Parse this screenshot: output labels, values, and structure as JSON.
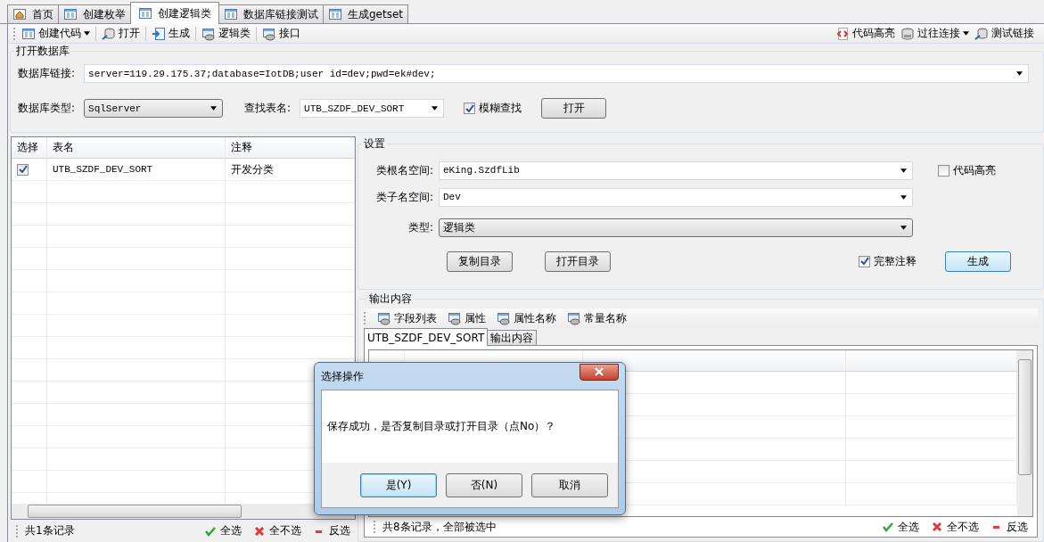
{
  "tabs": [
    {
      "label": "首页",
      "selected": false
    },
    {
      "label": "创建枚举",
      "selected": false
    },
    {
      "label": "创建逻辑类",
      "selected": true
    },
    {
      "label": "数据库链接测试",
      "selected": false
    },
    {
      "label": "生成getset",
      "selected": false
    }
  ],
  "toolbar": {
    "left": [
      {
        "label": "创建代码",
        "dropdown": true
      },
      {
        "label": "打开",
        "dropdown": false
      },
      {
        "label": "生成",
        "dropdown": false
      },
      {
        "label": "逻辑类",
        "dropdown": false
      },
      {
        "label": "接口",
        "dropdown": false
      }
    ],
    "right": [
      {
        "label": "代码高亮",
        "dropdown": false
      },
      {
        "label": "过往连接",
        "dropdown": true
      },
      {
        "label": "测试链接",
        "dropdown": false
      }
    ]
  },
  "open_db": {
    "title": "打开数据库",
    "connection_label": "数据库链接:",
    "connection_value": "server=119.29.175.37;database=IotDB;user id=dev;pwd=ek#dev;",
    "db_type_label": "数据库类型:",
    "db_type_value": "SqlServer",
    "table_label": "查找表名:",
    "table_value": "UTB_SZDF_DEV_SORT",
    "fuzzy": {
      "label": "模糊查找",
      "checked": true
    },
    "open_button": "打开"
  },
  "table_list": {
    "columns": [
      "选择",
      "表名",
      "注释"
    ],
    "rows": [
      {
        "checked": true,
        "name": "UTB_SZDF_DEV_SORT",
        "comment": "开发分类"
      }
    ],
    "status": "共1条记录",
    "actions": [
      "全选",
      "全不选",
      "反选"
    ]
  },
  "settings": {
    "title": "设置",
    "root_ns_label": "类根名空间:",
    "root_ns_value": "eKing.SzdfLib",
    "sub_ns_label": "类子名空间:",
    "sub_ns_value": "Dev",
    "type_label": "类型:",
    "type_value": "逻辑类",
    "highlight": {
      "label": "代码高亮",
      "checked": false
    },
    "full_comment": {
      "label": "完整注释",
      "checked": true
    },
    "buttons": [
      "复制目录",
      "打开目录"
    ],
    "generate_button": "生成"
  },
  "output": {
    "title": "输出内容",
    "toolbar": [
      "字段列表",
      "属性",
      "属性名称",
      "常量名称"
    ],
    "tabs": [
      {
        "label": "UTB_SZDF_DEV_SORT",
        "selected": true
      },
      {
        "label": "输出内容",
        "selected": false
      }
    ],
    "status": "共8条记录，全部被选中",
    "actions": [
      "全选",
      "全不选",
      "反选"
    ]
  },
  "dialog": {
    "title": "选择操作",
    "message": "保存成功，是否复制目录或打开目录（点No）？",
    "buttons": [
      {
        "label": "是(Y)",
        "focused": true
      },
      {
        "label": "否(N)",
        "focused": false
      },
      {
        "label": "取消",
        "focused": false
      }
    ]
  }
}
